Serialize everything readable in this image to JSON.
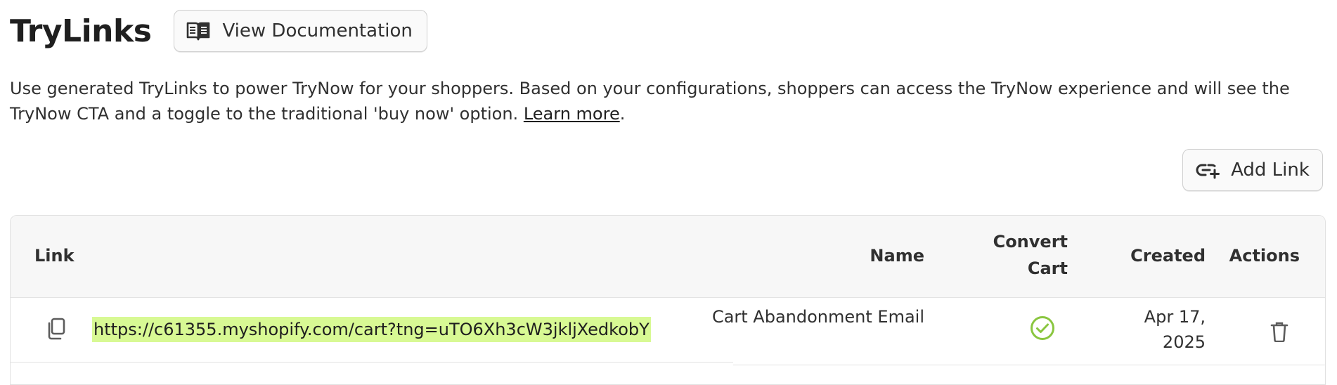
{
  "page": {
    "title": "TryLinks",
    "doc_button_label": "View Documentation",
    "description": "Use generated TryLinks to power TryNow for your shoppers. Based on your configurations, shoppers can access the TryNow experience and will see the TryNow CTA and a toggle to the traditional 'buy now' option.",
    "learn_more_label": "Learn more",
    "add_button_label": "Add Link"
  },
  "table": {
    "columns": {
      "link": "Link",
      "name": "Name",
      "convert_cart": "Convert Cart",
      "created": "Created",
      "actions": "Actions"
    },
    "rows": [
      {
        "link": "https://c61355.myshopify.com/cart?tng=uTO6Xh3cW3jkljXedkobY",
        "name": "Cart Abandonment Email",
        "convert_cart": true,
        "created": "Apr 17, 2025"
      }
    ]
  },
  "colors": {
    "link_highlight": "#d8f994",
    "check": "#8ac640"
  },
  "icons": [
    "book-icon",
    "add-link-icon",
    "copy-icon",
    "check-circle-icon",
    "trash-icon"
  ]
}
